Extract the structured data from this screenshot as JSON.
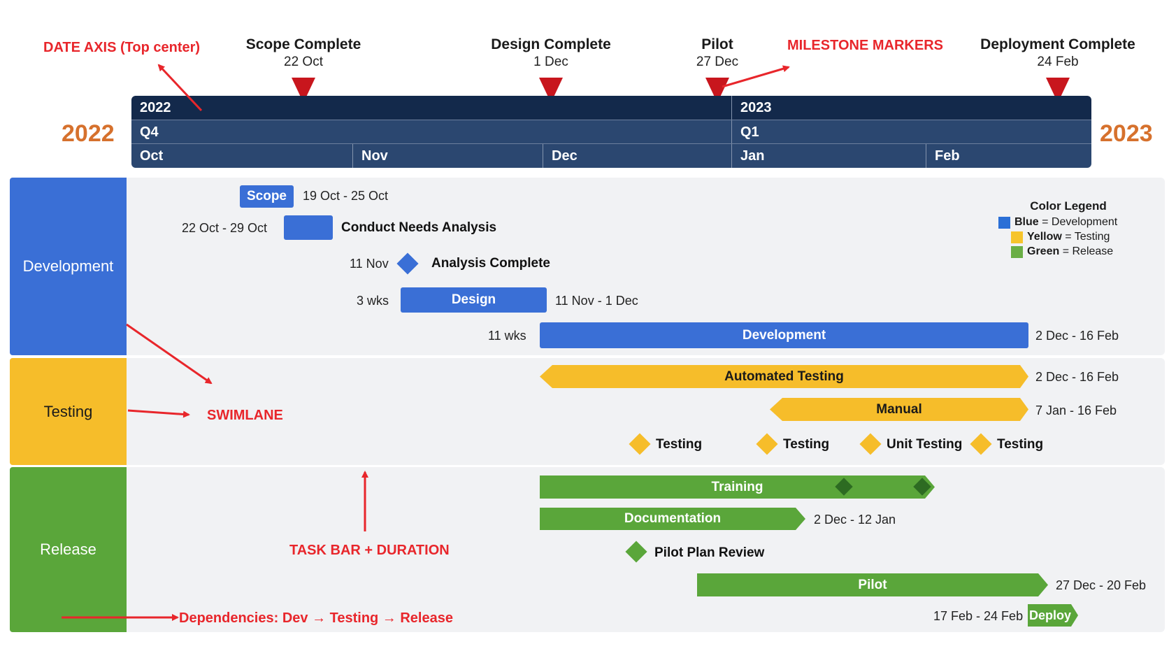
{
  "milestones": [
    {
      "title": "Scope Complete",
      "date": "22 Oct"
    },
    {
      "title": "Design Complete",
      "date": "1 Dec"
    },
    {
      "title": "Pilot",
      "date": "27 Dec"
    },
    {
      "title": "Deployment Complete",
      "date": "24 Feb"
    }
  ],
  "axis": {
    "years": [
      "2022",
      "2023"
    ],
    "quarters": [
      "Q4",
      "Q1"
    ],
    "months": [
      "Oct",
      "Nov",
      "Dec",
      "Jan",
      "Feb"
    ],
    "side_left": "2022",
    "side_right": "2023"
  },
  "lanes": {
    "development": "Development",
    "testing": "Testing",
    "release": "Release"
  },
  "dev": {
    "scope_bar": "Scope",
    "scope_dates": "19 Oct - 25 Oct",
    "needs_dates": "22 Oct - 29 Oct",
    "needs_label": "Conduct Needs Analysis",
    "analysis_date": "11 Nov",
    "analysis_label": "Analysis Complete",
    "design_duration": "3 wks",
    "design_bar": "Design",
    "design_dates": "11 Nov - 1 Dec",
    "dev_duration": "11 wks",
    "dev_bar": "Development",
    "dev_dates": "2 Dec - 16 Feb"
  },
  "test": {
    "auto_bar": "Automated Testing",
    "auto_dates": "2 Dec - 16 Feb",
    "manual_bar": "Manual",
    "manual_dates": "7 Jan - 16 Feb",
    "m1": "Testing",
    "m2": "Testing",
    "m3": "Unit Testing",
    "m4": "Testing"
  },
  "rel": {
    "training_bar": "Training",
    "doc_bar": "Documentation",
    "doc_dates": "2 Dec - 12 Jan",
    "pilot_review": "Pilot Plan Review",
    "pilot_bar": "Pilot",
    "pilot_dates": "27 Dec - 20 Feb",
    "deploy_dates": "17 Feb - 24 Feb",
    "deploy_bar": "Deploy"
  },
  "legend": {
    "title": "Color Legend",
    "items": [
      {
        "key": "Blue",
        "desc": " = Development",
        "color": "#2a6fd6"
      },
      {
        "key": "Yellow",
        "desc": " = Testing",
        "color": "#f6c42c"
      },
      {
        "key": "Green",
        "desc": " = Release",
        "color": "#6aae45"
      }
    ]
  },
  "annotations": {
    "date_axis": "DATE AXIS (Top center)",
    "milestone_markers": "MILESTONE MARKERS",
    "swimlane": "SWIMLANE",
    "task_bar": "TASK BAR + DURATION",
    "dependencies": "Dependencies: Dev → Testing → Release"
  },
  "colors": {
    "axis_dark": "#13294b",
    "axis_mid": "#2b4770",
    "milestone_red": "#c8161d",
    "annotation_red": "#e8262b",
    "year_orange": "#d6712d",
    "dev_lane": "#3a6fd6",
    "test_lane": "#f6bd2a",
    "release_lane": "#5aa63a"
  }
}
